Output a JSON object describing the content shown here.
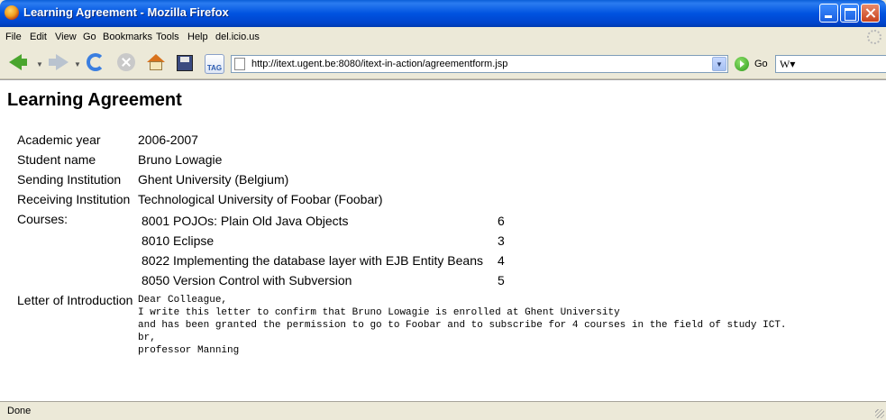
{
  "window": {
    "title": "Learning Agreement - Mozilla Firefox"
  },
  "menu": {
    "items": [
      "File",
      "Edit",
      "View",
      "Go",
      "Bookmarks",
      "Tools",
      "Help",
      "del.icio.us"
    ]
  },
  "toolbar": {
    "url": "http://itext.ugent.be:8080/itext-in-action/agreementform.jsp",
    "go_label": "Go",
    "tag_label": "TAG",
    "search_icon_text": "W"
  },
  "page": {
    "heading": "Learning Agreement",
    "fields": {
      "academic_year": {
        "label": "Academic year",
        "value": "2006-2007"
      },
      "student_name": {
        "label": "Student name",
        "value": "Bruno Lowagie"
      },
      "sending_institution": {
        "label": "Sending Institution",
        "value": "Ghent University (Belgium)"
      },
      "receiving_institution": {
        "label": "Receiving Institution",
        "value": "Technological University of Foobar (Foobar)"
      }
    },
    "courses_label": "Courses:",
    "courses": [
      {
        "name": "8001 POJOs: Plain Old Java Objects",
        "credits": "6"
      },
      {
        "name": "8010 Eclipse",
        "credits": "3"
      },
      {
        "name": "8022 Implementing the database layer with EJB Entity Beans",
        "credits": "4"
      },
      {
        "name": "8050 Version Control with Subversion",
        "credits": "5"
      }
    ],
    "letter_label": "Letter of Introduction",
    "letter_lines": [
      "Dear Colleague,",
      "I write this letter to confirm that Bruno Lowagie is enrolled at Ghent University",
      "and has been granted the permission to go to Foobar and to subscribe for 4 courses in the field of study ICT.",
      "br,",
      "professor Manning"
    ]
  },
  "status": {
    "text": "Done"
  }
}
